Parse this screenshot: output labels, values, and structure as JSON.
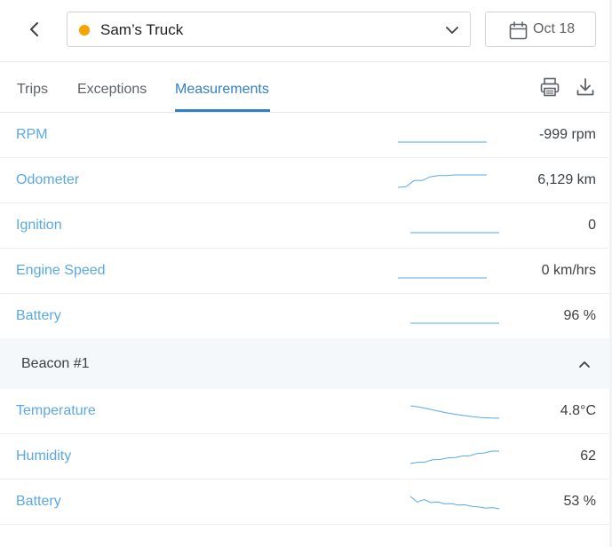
{
  "header": {
    "vehicle": {
      "name": "Sam’s Truck",
      "status_color": "#f5a300"
    },
    "date": {
      "label": "Oct 18"
    }
  },
  "tabs": [
    {
      "label": "Trips",
      "active": false
    },
    {
      "label": "Exceptions",
      "active": false
    },
    {
      "label": "Measurements",
      "active": true
    }
  ],
  "toolbar": {
    "icons": [
      "print-icon",
      "download-icon"
    ]
  },
  "measurements": [
    {
      "label": "RPM",
      "value": "-999 rpm",
      "trend": [
        0,
        0,
        0,
        0,
        0,
        0
      ]
    },
    {
      "label": "Odometer",
      "value": "6,129 km",
      "trend": [
        0,
        0.05,
        0.55,
        0.55,
        0.85,
        0.95,
        0.95,
        1,
        1,
        1,
        1,
        1
      ]
    },
    {
      "label": "Ignition",
      "value": "0",
      "trend": [
        0,
        0,
        0,
        0,
        0,
        0
      ]
    },
    {
      "label": "Engine Speed",
      "value": "0 km/hrs",
      "trend": [
        0,
        0,
        0,
        0,
        0,
        0
      ]
    },
    {
      "label": "Battery",
      "value": "96 %",
      "trend": [
        0,
        0,
        0,
        0,
        0,
        0
      ]
    }
  ],
  "beacon": {
    "title": "Beacon #1",
    "expanded": true,
    "measurements": [
      {
        "label": "Temperature",
        "value": "4.8°C",
        "trend": [
          1,
          0.9,
          0.75,
          0.6,
          0.45,
          0.32,
          0.22,
          0.12,
          0.05,
          0.02,
          0
        ]
      },
      {
        "label": "Humidity",
        "value": "62",
        "trend": [
          0,
          0.1,
          0.12,
          0.3,
          0.32,
          0.45,
          0.48,
          0.6,
          0.62,
          0.8,
          0.85,
          1,
          1
        ]
      },
      {
        "label": "Battery",
        "value": "53 %",
        "trend": [
          1,
          0.55,
          0.75,
          0.5,
          0.55,
          0.4,
          0.42,
          0.3,
          0.32,
          0.2,
          0.15,
          0.05,
          0.1,
          0
        ]
      }
    ]
  },
  "colors": {
    "accent": "#2f80c9",
    "label": "#5aa9e6",
    "sparkline": "#5aa9e6",
    "section_bg": "#f4f8fb"
  }
}
